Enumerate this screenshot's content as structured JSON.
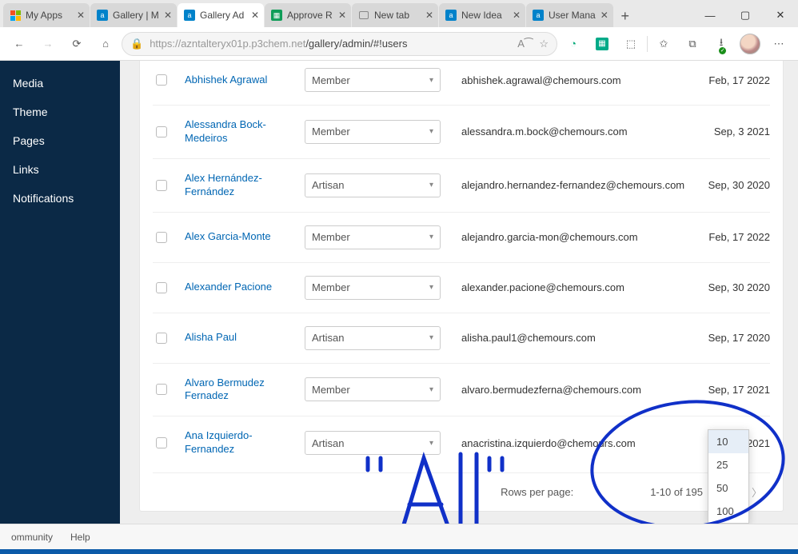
{
  "browser": {
    "tabs": [
      {
        "title": "My Apps",
        "favicon": "ms"
      },
      {
        "title": "Gallery | M",
        "favicon": "ax"
      },
      {
        "title": "Gallery Ad",
        "favicon": "ax",
        "active": true
      },
      {
        "title": "Approve R",
        "favicon": "gs"
      },
      {
        "title": "New tab",
        "favicon": "nt"
      },
      {
        "title": "New Idea",
        "favicon": "ax"
      },
      {
        "title": "User Mana",
        "favicon": "ax"
      }
    ],
    "url_host": "https://azntalteryx01p.p3chem.net",
    "url_path": "/gallery/admin/#!users"
  },
  "sidebar": {
    "items": [
      "Media",
      "Theme",
      "Pages",
      "Links",
      "Notifications"
    ]
  },
  "users": [
    {
      "name": "Abhishek Agrawal",
      "role": "Member",
      "email": "abhishek.agrawal@chemours.com",
      "date": "Feb, 17 2022"
    },
    {
      "name": "Alessandra Bock-Medeiros",
      "role": "Member",
      "email": "alessandra.m.bock@chemours.com",
      "date": "Sep, 3 2021"
    },
    {
      "name": "Alex Hernández-Fernández",
      "role": "Artisan",
      "email": "alejandro.hernandez-fernandez@chemours.com",
      "date": "Sep, 30 2020"
    },
    {
      "name": "Alex Garcia-Monte",
      "role": "Member",
      "email": "alejandro.garcia-mon@chemours.com",
      "date": "Feb, 17 2022"
    },
    {
      "name": "Alexander Pacione",
      "role": "Member",
      "email": "alexander.pacione@chemours.com",
      "date": "Sep, 30 2020"
    },
    {
      "name": "Alisha Paul",
      "role": "Artisan",
      "email": "alisha.paul1@chemours.com",
      "date": "Sep, 17 2020"
    },
    {
      "name": "Alvaro Bermudez Fernadez",
      "role": "Member",
      "email": "alvaro.bermudezferna@chemours.com",
      "date": "Sep, 17 2021"
    },
    {
      "name": "Ana Izquierdo-Fernandez",
      "role": "Artisan",
      "email": "anacristina.izquierdo@chemours.com",
      "date": "Mar, 19 2021"
    }
  ],
  "pagination": {
    "rows_per_page_label": "Rows per page:",
    "range_label": "1-10 of 195",
    "options": [
      "10",
      "25",
      "50",
      "100"
    ],
    "selected": "10"
  },
  "footer": {
    "community": "ommunity",
    "help": "Help"
  },
  "annotation": {
    "text": "\"All\""
  }
}
